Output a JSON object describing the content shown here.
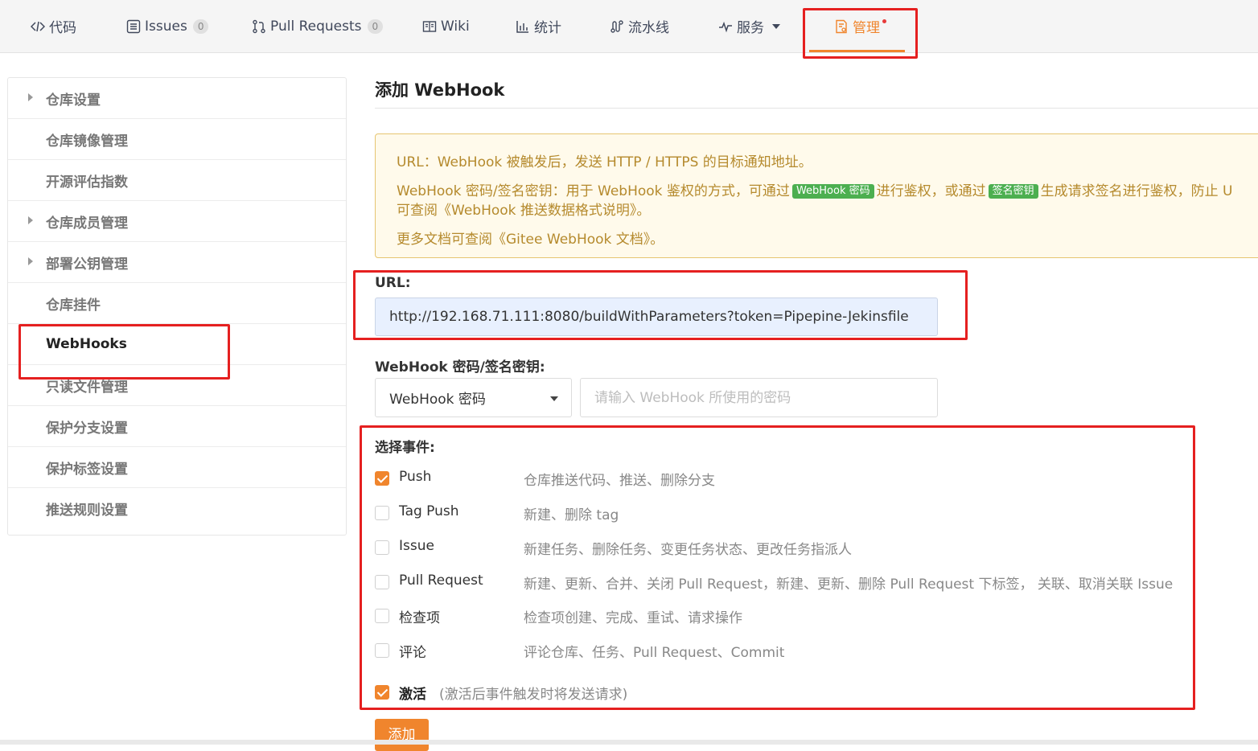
{
  "nav": {
    "tabs": [
      {
        "label": "代码",
        "icon": "code-icon"
      },
      {
        "label": "Issues",
        "icon": "issues-icon",
        "count": "0"
      },
      {
        "label": "Pull Requests",
        "icon": "pull-request-icon",
        "count": "0"
      },
      {
        "label": "Wiki",
        "icon": "wiki-icon"
      },
      {
        "label": "统计",
        "icon": "chart-icon"
      },
      {
        "label": "流水线",
        "icon": "pipeline-icon"
      },
      {
        "label": "服务",
        "icon": "pulse-icon"
      },
      {
        "label": "管理",
        "icon": "manage-icon",
        "active": true
      }
    ]
  },
  "sidebar": {
    "items": [
      {
        "label": "仓库设置",
        "expandable": true
      },
      {
        "label": "仓库镜像管理"
      },
      {
        "label": "开源评估指数"
      },
      {
        "label": "仓库成员管理",
        "expandable": true
      },
      {
        "label": "部署公钥管理",
        "expandable": true
      },
      {
        "label": "仓库挂件"
      },
      {
        "label": "WebHooks",
        "active": true
      },
      {
        "label": "只读文件管理"
      },
      {
        "label": "保护分支设置"
      },
      {
        "label": "保护标签设置"
      },
      {
        "label": "推送规则设置"
      }
    ]
  },
  "main": {
    "title": "添加 WebHook",
    "notice": {
      "line1": "URL：WebHook 被触发后，发送 HTTP / HTTPS 的目标通知地址。",
      "line2_a": "WebHook 密码/签名密钥：用于 WebHook 鉴权的方式，可通过",
      "tag1": "WebHook 密码",
      "line2_b": "进行鉴权，或通过",
      "tag2": "签名密钥",
      "line2_c": "生成请求签名进行鉴权，防止 U",
      "line3": "可查阅《WebHook 推送数据格式说明》。",
      "line4": "更多文档可查阅《Gitee WebHook 文档》。"
    },
    "url_label": "URL:",
    "url_value": "http://192.168.71.111:8080/buildWithParameters?token=Pipepine-Jekinsfile",
    "secret_label": "WebHook 密码/签名密钥:",
    "secret_type": "WebHook 密码",
    "secret_placeholder": "请输入 WebHook 所使用的密码",
    "events_label": "选择事件:",
    "events": [
      {
        "name": "Push",
        "desc": "仓库推送代码、推送、删除分支",
        "checked": true
      },
      {
        "name": "Tag Push",
        "desc": "新建、删除 tag",
        "checked": false
      },
      {
        "name": "Issue",
        "desc": "新建任务、删除任务、变更任务状态、更改任务指派人",
        "checked": false
      },
      {
        "name": "Pull Request",
        "desc": "新建、更新、合并、关闭 Pull Request，新建、更新、删除 Pull Request 下标签， 关联、取消关联 Issue",
        "checked": false
      },
      {
        "name": "检查项",
        "desc": "检查项创建、完成、重试、请求操作",
        "checked": false
      },
      {
        "name": "评论",
        "desc": "评论仓库、任务、Pull Request、Commit",
        "checked": false
      }
    ],
    "activate": {
      "label": "激活",
      "hint": "(激活后事件触发时将发送请求)",
      "checked": true
    },
    "submit_label": "添加"
  },
  "colors": {
    "accent": "#f0852d",
    "annotation": "#e52020",
    "notice_bg": "#fffaeb",
    "notice_text": "#b58a2d",
    "tag": "#4caf50"
  }
}
